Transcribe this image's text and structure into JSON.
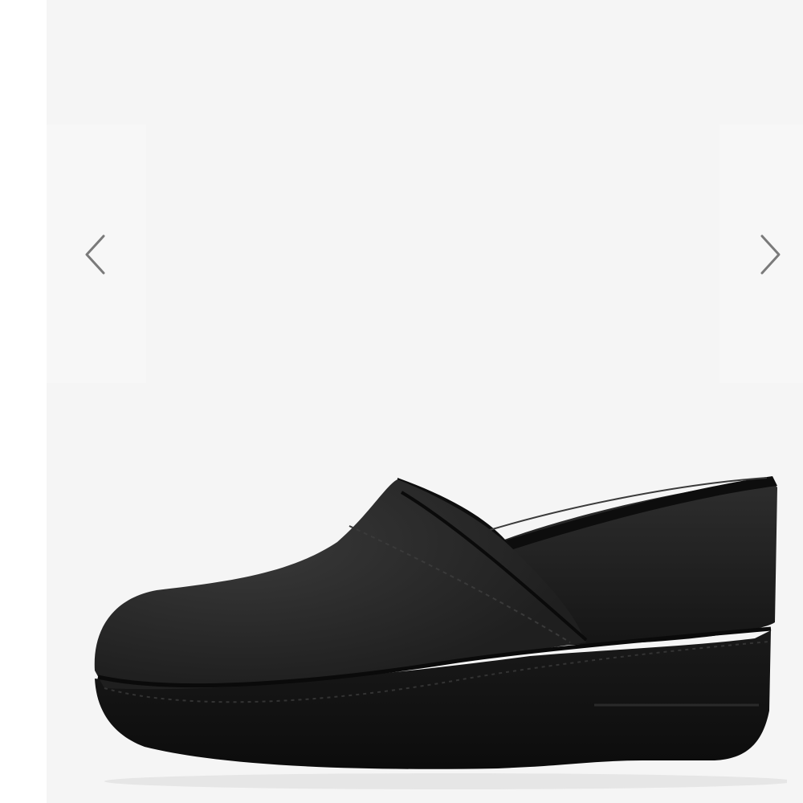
{
  "gallery": {
    "prev_icon": "chevron-left-icon",
    "next_icon": "chevron-right-icon",
    "colors": {
      "stage_background": "#f5f5f5",
      "chevron": "#7a7a7a",
      "product": "#1c1c1c"
    }
  }
}
